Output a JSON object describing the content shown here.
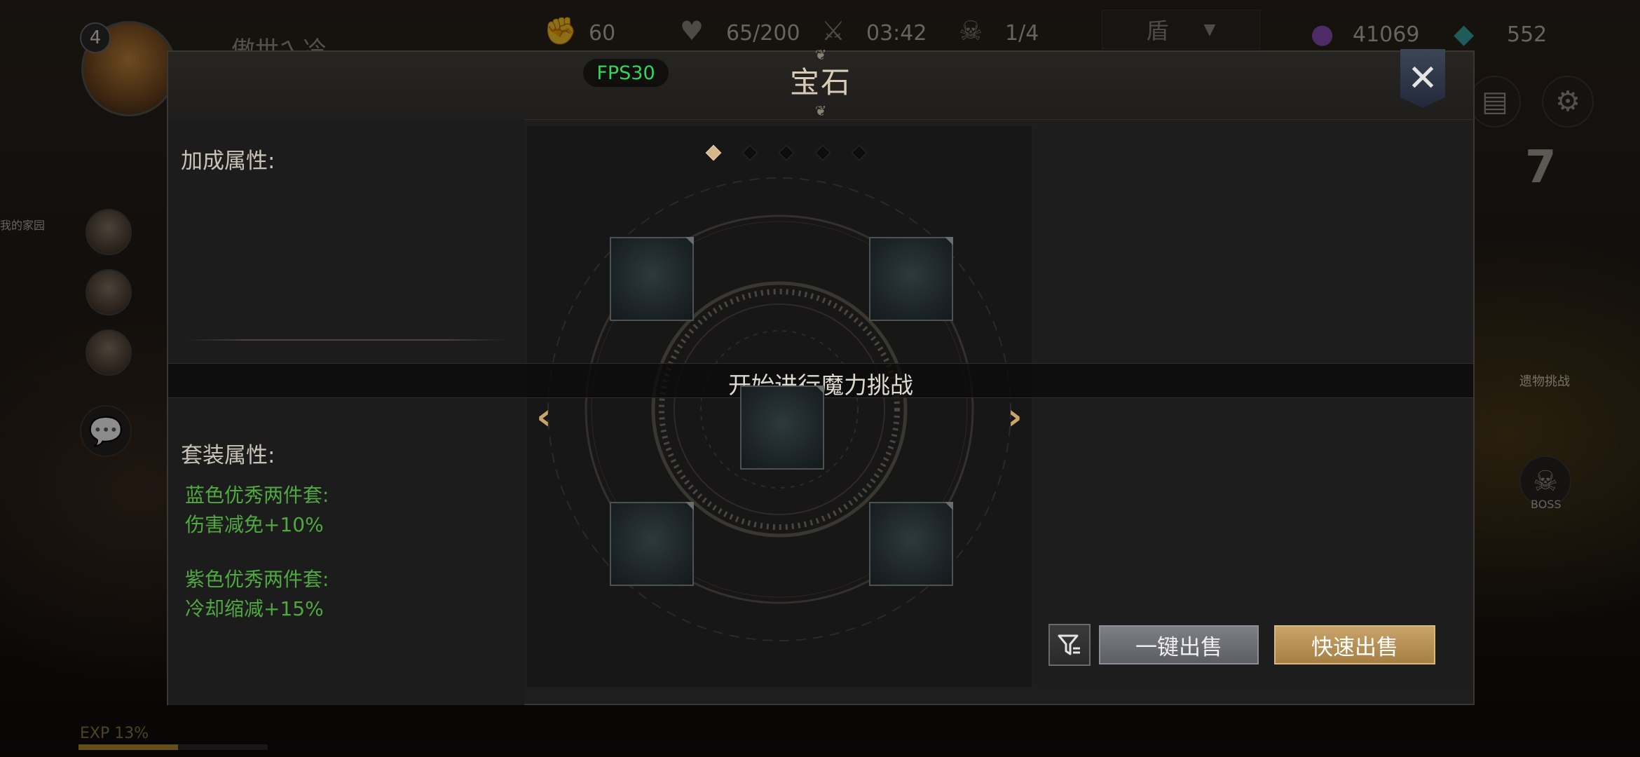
{
  "hud": {
    "player_level": "4",
    "player_name": "傲世ㄟ冷",
    "stamina": "60",
    "hp": "65/200",
    "timer": "03:42",
    "boss_count": "1/4",
    "class_select": "盾",
    "currency_purple": "41069",
    "currency_teal": "552",
    "exp_label": "EXP 13%",
    "exp_percent": 13,
    "stage_number": "7",
    "relic_challenge_label": "遗物挑战",
    "boss_label": "BOSS",
    "side_tag": "我的家园"
  },
  "modal": {
    "title": "宝石",
    "fps": "FPS30",
    "bonus_label": "加成属性:",
    "set_label": "套装属性:",
    "set_bonuses": [
      {
        "name": "蓝色优秀两件套:",
        "effect": "伤害减免+10%"
      },
      {
        "name": "紫色优秀两件套:",
        "effect": "冷却缩减+15%"
      }
    ],
    "banner": "开始进行魔力挑战",
    "pages": {
      "total": 5,
      "active": 1
    },
    "filter_icon": "filter-icon",
    "sell_all": "一键出售",
    "quick_sell": "快速出售"
  },
  "colors": {
    "accent_gold": "#c9a46a",
    "set_bonus_green": "#4fa840",
    "fps_green": "#33d65a"
  }
}
